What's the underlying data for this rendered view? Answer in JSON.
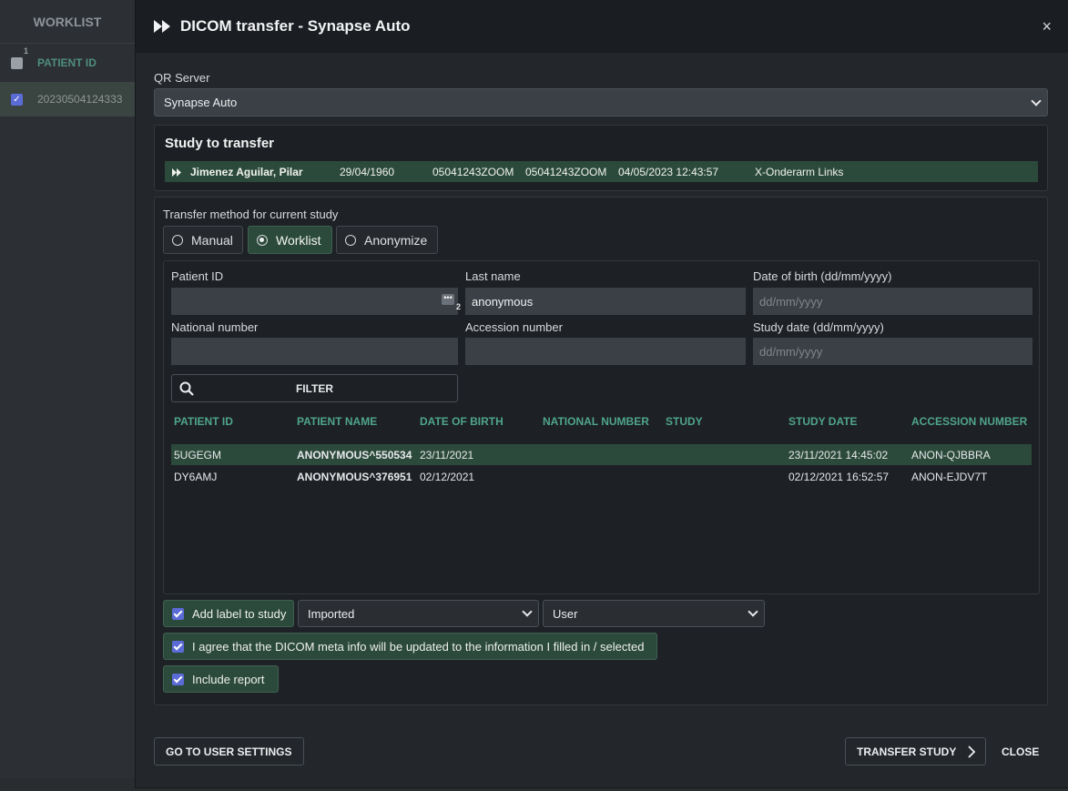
{
  "background": {
    "worklist_title": "WORKLIST",
    "column_count": "1",
    "column_header": "PATIENT ID",
    "row_value": "20230504124333"
  },
  "modal": {
    "title": "DICOM transfer - Synapse Auto",
    "close_icon": "×",
    "qr_server_label": "QR Server",
    "qr_server_value": "Synapse Auto",
    "study": {
      "title": "Study to transfer",
      "patient_name": "Jimenez Aguilar, Pilar",
      "dob": "29/04/1960",
      "id1": "05041243ZOOM",
      "id2": "05041243ZOOM",
      "datetime": "04/05/2023 12:43:57",
      "description": "X-Onderarm Links"
    },
    "method": {
      "label": "Transfer method for current study",
      "options": [
        "Manual",
        "Worklist",
        "Anonymize"
      ],
      "selected": "Worklist"
    },
    "fields": {
      "patient_id_label": "Patient ID",
      "patient_id_value": "",
      "patient_id_badge": "2",
      "last_name_label": "Last name",
      "last_name_value": "anonymous",
      "dob_label": "Date of birth (dd/mm/yyyy)",
      "dob_placeholder": "dd/mm/yyyy",
      "national_number_label": "National number",
      "accession_label": "Accession number",
      "study_date_label": "Study date (dd/mm/yyyy)",
      "study_date_placeholder": "dd/mm/yyyy",
      "filter_label": "FILTER"
    },
    "table": {
      "headers": [
        "PATIENT ID",
        "PATIENT NAME",
        "DATE OF BIRTH",
        "NATIONAL NUMBER",
        "STUDY",
        "STUDY DATE",
        "ACCESSION NUMBER"
      ],
      "rows": [
        {
          "patient_id": "5UGEGM",
          "name": "ANONYMOUS^550534",
          "dob": "23/11/2021",
          "national": "",
          "study": "",
          "study_date": "23/11/2021 14:45:02",
          "accession": "ANON-QJBBRA"
        },
        {
          "patient_id": "DY6AMJ",
          "name": "ANONYMOUS^376951",
          "dob": "02/12/2021",
          "national": "",
          "study": "",
          "study_date": "02/12/2021 16:52:57",
          "accession": "ANON-EJDV7T"
        }
      ]
    },
    "options": {
      "add_label": "Add label to study",
      "label_select": "Imported",
      "user_select": "User",
      "agree": "I agree that the DICOM meta info will be updated to the information I filled in / selected",
      "include_report": "Include report"
    },
    "footer": {
      "user_settings": "GO TO USER SETTINGS",
      "transfer": "TRANSFER STUDY",
      "close": "CLOSE"
    }
  }
}
